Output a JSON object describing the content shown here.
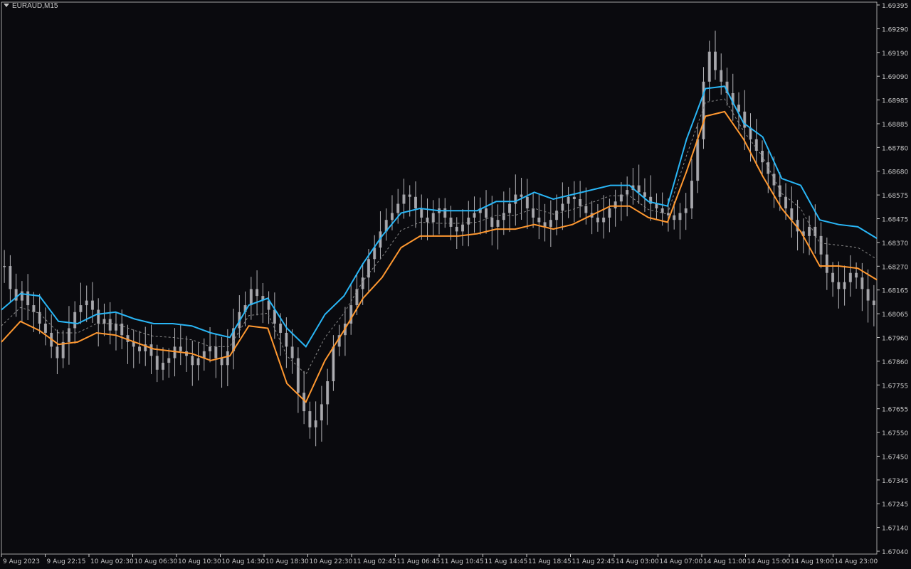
{
  "symbol_label": "EURAUD,M15",
  "colors": {
    "background": "#0a0a0e",
    "candle": "#b4b4b8",
    "upper_band": "#29b6f6",
    "lower_band": "#ff9830",
    "middle_band": "#8a8a8a",
    "axis": "#c8c8c8"
  },
  "chart_data": {
    "type": "line",
    "title": "EURAUD,M15",
    "ylim": [
      1.67,
      1.69395
    ],
    "y_ticks": [
      "1.69395",
      "1.69290",
      "1.69190",
      "1.69090",
      "1.68985",
      "1.68885",
      "1.68780",
      "1.68680",
      "1.68575",
      "1.68475",
      "1.68370",
      "1.68270",
      "1.68165",
      "1.68065",
      "1.67960",
      "1.67860",
      "1.67755",
      "1.67655",
      "1.67550",
      "1.67450",
      "1.67345",
      "1.67245",
      "1.67140",
      "1.67040"
    ],
    "x_ticks": [
      "9 Aug 2023",
      "9 Aug 22:15",
      "10 Aug 02:30",
      "10 Aug 06:30",
      "10 Aug 10:30",
      "10 Aug 14:30",
      "10 Aug 18:30",
      "10 Aug 22:30",
      "11 Aug 02:45",
      "11 Aug 06:45",
      "11 Aug 10:45",
      "11 Aug 14:45",
      "11 Aug 18:45",
      "11 Aug 22:45",
      "14 Aug 03:00",
      "14 Aug 07:00",
      "14 Aug 11:00",
      "14 Aug 15:00",
      "14 Aug 19:00",
      "14 Aug 23:00"
    ],
    "series": [
      {
        "kind": "upper",
        "values": [
          1.6806,
          1.6813,
          1.6812,
          1.6801,
          1.68,
          1.6804,
          1.6805,
          1.6802,
          1.68,
          1.68,
          1.6799,
          1.6796,
          1.6794,
          1.6808,
          1.6811,
          1.6798,
          1.679,
          1.6804,
          1.6812,
          1.6826,
          1.6838,
          1.6848,
          1.685,
          1.6849,
          1.6849,
          1.6849,
          1.6853,
          1.6853,
          1.6857,
          1.6854,
          1.6856,
          1.6858,
          1.686,
          1.686,
          1.6853,
          1.6851,
          1.688,
          1.6902,
          1.6903,
          1.6887,
          1.6881,
          1.6863,
          1.686,
          1.6845,
          1.6843,
          1.6842,
          1.6837
        ]
      },
      {
        "kind": "lower",
        "values": [
          1.6792,
          1.6801,
          1.6797,
          1.6791,
          1.6792,
          1.6796,
          1.6795,
          1.6792,
          1.6789,
          1.6788,
          1.6787,
          1.6784,
          1.6786,
          1.6799,
          1.6798,
          1.6774,
          1.6766,
          1.6784,
          1.6797,
          1.6811,
          1.682,
          1.6833,
          1.6838,
          1.6838,
          1.6838,
          1.6839,
          1.6841,
          1.6841,
          1.6843,
          1.6841,
          1.6843,
          1.6847,
          1.6851,
          1.6851,
          1.6846,
          1.6844,
          1.6866,
          1.689,
          1.6892,
          1.688,
          1.6864,
          1.685,
          1.684,
          1.6825,
          1.6825,
          1.6824,
          1.6819
        ]
      }
    ]
  },
  "ohlc": [
    1.6825,
    1.6815,
    1.681,
    1.6814,
    1.6808,
    1.6805,
    1.68,
    1.6796,
    1.679,
    1.6785,
    1.6792,
    1.6798,
    1.6805,
    1.6808,
    1.681,
    1.6806,
    1.68,
    1.6802,
    1.6797,
    1.68,
    1.6795,
    1.6792,
    1.679,
    1.6788,
    1.6791,
    1.6786,
    1.678,
    1.6783,
    1.6785,
    1.679,
    1.6788,
    1.6786,
    1.6782,
    1.6785,
    1.6788,
    1.679,
    1.6785,
    1.6782,
    1.6788,
    1.6798,
    1.6805,
    1.6808,
    1.6815,
    1.6812,
    1.681,
    1.6806,
    1.68,
    1.6796,
    1.679,
    1.6785,
    1.677,
    1.6762,
    1.6755,
    1.6758,
    1.6765,
    1.6775,
    1.679,
    1.6795,
    1.68,
    1.6808,
    1.6815,
    1.682,
    1.6828,
    1.6833,
    1.684,
    1.6845,
    1.6848,
    1.6852,
    1.6856,
    1.6855,
    1.685,
    1.6846,
    1.6844,
    1.6848,
    1.685,
    1.6846,
    1.6842,
    1.684,
    1.6843,
    1.6846,
    1.6848,
    1.685,
    1.6846,
    1.6842,
    1.6845,
    1.6848,
    1.6852,
    1.6856,
    1.6855,
    1.685,
    1.6846,
    1.6844,
    1.6842,
    1.6845,
    1.6849,
    1.6852,
    1.6855,
    1.6854,
    1.6851,
    1.6848,
    1.6846,
    1.6844,
    1.6846,
    1.685,
    1.6853,
    1.6856,
    1.6858,
    1.686,
    1.6857,
    1.6855,
    1.6852,
    1.685,
    1.6848,
    1.6847,
    1.6845,
    1.6848,
    1.685,
    1.6862,
    1.688,
    1.6905,
    1.6918,
    1.691,
    1.6905,
    1.69,
    1.6895,
    1.6892,
    1.6885,
    1.688,
    1.6875,
    1.687,
    1.6865,
    1.686,
    1.6855,
    1.685,
    1.6845,
    1.684,
    1.6838,
    1.6842,
    1.6838,
    1.683,
    1.6822,
    1.6818,
    1.6815,
    1.6818,
    1.6822,
    1.682,
    1.6815,
    1.681,
    1.6808
  ]
}
